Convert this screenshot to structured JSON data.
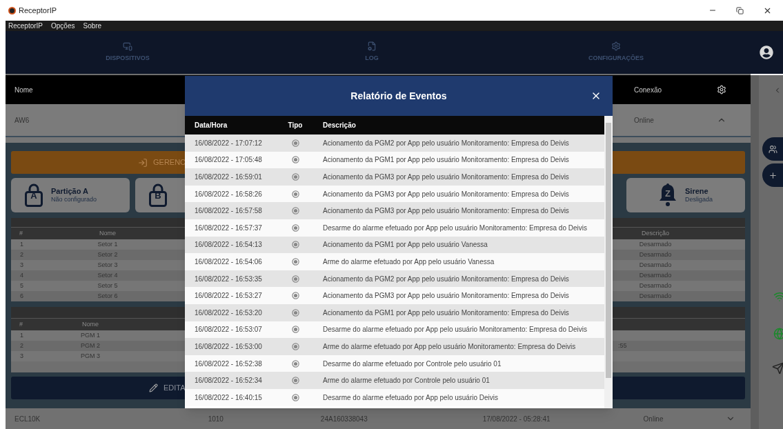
{
  "window": {
    "title": "ReceptorIP"
  },
  "menu": [
    "ReceptorIP",
    "Opções",
    "Sobre"
  ],
  "nav": [
    {
      "label": "DISPOSITIVOS"
    },
    {
      "label": "LOG"
    },
    {
      "label": "CONFIGURAÇÕES"
    }
  ],
  "device_table": {
    "columns": [
      "Nome",
      "Conexão"
    ],
    "devices": [
      {
        "name": "AW6",
        "connection": "Online",
        "expanded": true
      },
      {
        "name": "ECL10K",
        "column_2": "1010",
        "column_3": "24A160338043",
        "column_4": "17/08/2022 - 05:28:41",
        "connection": "Online",
        "expanded": false
      }
    ]
  },
  "device_panel": {
    "manage_button": "GERENC",
    "cards": [
      {
        "kind": "partition",
        "letter": "A",
        "title": "Partição A",
        "status": "Não configurado"
      },
      {
        "kind": "partition",
        "letter": "B"
      },
      {
        "kind": "siren",
        "letter": "Z",
        "title": "Sirene",
        "status": "Desligada"
      }
    ],
    "sectors": {
      "columns": [
        "#",
        "Nome",
        "Descrição"
      ],
      "rows": [
        {
          "number": "1",
          "name": "Setor 1",
          "description": "Desarmado"
        },
        {
          "number": "2",
          "name": "Setor 2",
          "description": "Desarmado"
        },
        {
          "number": "3",
          "name": "Setor 3",
          "description": "Desarmado"
        },
        {
          "number": "4",
          "name": "Setor 4",
          "description": "Desarmado"
        },
        {
          "number": "5",
          "name": "Setor 5",
          "description": "Desarmado"
        },
        {
          "number": "6",
          "name": "Setor 6",
          "description": "Desarmado"
        }
      ]
    },
    "pgms": {
      "columns": [
        "#",
        "Nome"
      ],
      "rows": [
        {
          "number": "1",
          "name": "PGM 1"
        },
        {
          "number": "2",
          "name": "PGM 2",
          "column_3": ":55"
        },
        {
          "number": "3",
          "name": "PGM 3"
        }
      ]
    },
    "edit_button": "EDITA"
  },
  "modal": {
    "title": "Relatório de Eventos",
    "columns": [
      "Data/Hora",
      "Tipo",
      "Descrição"
    ],
    "rows": [
      {
        "date": "16/08/2022 - 17:07:12",
        "description": "Acionamento da PGM2 por App pelo usuário Monitoramento: Empresa do Deivis"
      },
      {
        "date": "16/08/2022 - 17:05:48",
        "description": "Acionamento da PGM1 por App pelo usuário Monitoramento: Empresa do Deivis"
      },
      {
        "date": "16/08/2022 - 16:59:01",
        "description": "Acionamento da PGM3 por App pelo usuário Monitoramento: Empresa do Deivis"
      },
      {
        "date": "16/08/2022 - 16:58:26",
        "description": "Acionamento da PGM3 por App pelo usuário Monitoramento: Empresa do Deivis"
      },
      {
        "date": "16/08/2022 - 16:57:58",
        "description": "Acionamento da PGM3 por App pelo usuário Monitoramento: Empresa do Deivis"
      },
      {
        "date": "16/08/2022 - 16:57:37",
        "description": "Desarme do alarme efetuado por App pelo usuário Monitoramento: Empresa do Deivis"
      },
      {
        "date": "16/08/2022 - 16:54:13",
        "description": "Acionamento da PGM1 por App pelo usuário Vanessa"
      },
      {
        "date": "16/08/2022 - 16:54:06",
        "description": "Arme do alarme efetuado por App pelo usuário Vanessa"
      },
      {
        "date": "16/08/2022 - 16:53:35",
        "description": "Acionamento da PGM2 por App pelo usuário Monitoramento: Empresa do Deivis"
      },
      {
        "date": "16/08/2022 - 16:53:27",
        "description": "Acionamento da PGM3 por App pelo usuário Monitoramento: Empresa do Deivis"
      },
      {
        "date": "16/08/2022 - 16:53:20",
        "description": "Acionamento da PGM1 por App pelo usuário Monitoramento: Empresa do Deivis"
      },
      {
        "date": "16/08/2022 - 16:53:07",
        "description": "Desarme do alarme efetuado por App pelo usuário Monitoramento: Empresa do Deivis"
      },
      {
        "date": "16/08/2022 - 16:53:00",
        "description": "Arme do alarme efetuado por App pelo usuário Monitoramento: Empresa do Deivis"
      },
      {
        "date": "16/08/2022 - 16:52:38",
        "description": "Desarme do alarme efetuado por Controle pelo usuário 01"
      },
      {
        "date": "16/08/2022 - 16:52:34",
        "description": "Arme do alarme efetuado por Controle pelo usuário 01"
      },
      {
        "date": "16/08/2022 - 16:40:15",
        "description": "Desarme do alarme efetuado por App pelo usuário Deivis"
      }
    ]
  }
}
